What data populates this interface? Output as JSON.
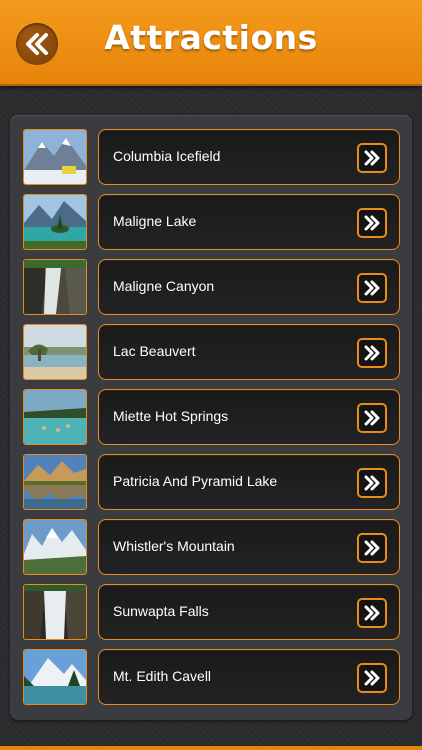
{
  "header": {
    "title": "Attractions",
    "back_icon": "double-chevron-left-icon",
    "accent": "#F08F14"
  },
  "list": [
    {
      "label": "Columbia Icefield",
      "thumb": "mountain-glacier"
    },
    {
      "label": "Maligne Lake",
      "thumb": "lake-island"
    },
    {
      "label": "Maligne Canyon",
      "thumb": "canyon-waterfall"
    },
    {
      "label": "Lac Beauvert",
      "thumb": "lake-shore"
    },
    {
      "label": "Miette Hot Springs",
      "thumb": "hot-springs-pool"
    },
    {
      "label": "Patricia And Pyramid Lake",
      "thumb": "mountain-reflection"
    },
    {
      "label": "Whistler's Mountain",
      "thumb": "mountain-range"
    },
    {
      "label": "Sunwapta Falls",
      "thumb": "waterfall"
    },
    {
      "label": "Mt. Edith Cavell",
      "thumb": "mountain-lake"
    }
  ],
  "row_action_icon": "double-chevron-right-icon"
}
